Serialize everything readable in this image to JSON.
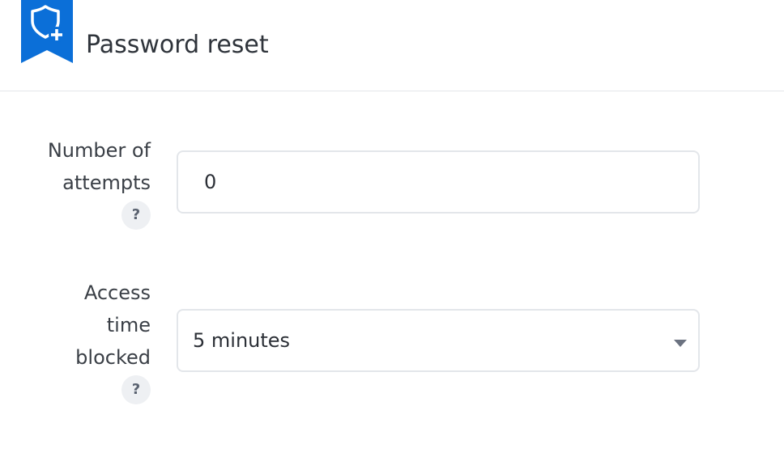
{
  "header": {
    "title": "Password reset",
    "icon": "shield-plus-icon",
    "accent_color": "#0b6fd8"
  },
  "form": {
    "attempts": {
      "label_line1": "Number of",
      "label_line2": "attempts",
      "help": "?",
      "value": "0"
    },
    "blocked": {
      "label_line1": "Access",
      "label_line2": "time",
      "label_line3": "blocked",
      "help": "?",
      "selected": "5 minutes",
      "caret_icon": "chevron-down-icon"
    }
  }
}
